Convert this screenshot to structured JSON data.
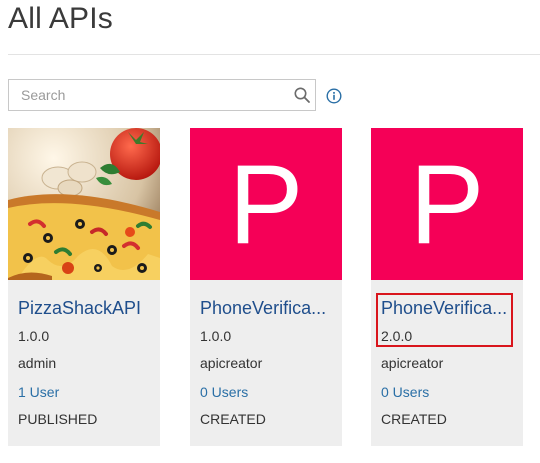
{
  "page": {
    "title": "All APIs"
  },
  "search": {
    "placeholder": "Search"
  },
  "icons": {
    "search": "search-icon",
    "info": "info-icon"
  },
  "colors": {
    "tile_accent": "#f50057",
    "link": "#1f4e8c",
    "highlight": "#d9151c"
  },
  "apis": [
    {
      "name": "PizzaShackAPI",
      "version": "1.0.0",
      "owner": "admin",
      "users": "1 User",
      "status": "PUBLISHED",
      "thumbnail": "pizza-image"
    },
    {
      "name": "PhoneVerifica...",
      "version": "1.0.0",
      "owner": "apicreator",
      "users": "0 Users",
      "status": "CREATED",
      "thumbnail_letter": "P"
    },
    {
      "name": "PhoneVerifica...",
      "version": "2.0.0",
      "owner": "apicreator",
      "users": "0 Users",
      "status": "CREATED",
      "thumbnail_letter": "P"
    }
  ]
}
